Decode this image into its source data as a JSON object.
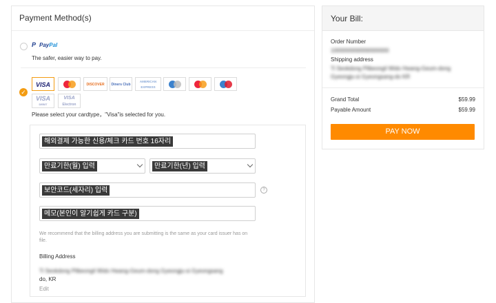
{
  "payment": {
    "title": "Payment Method(s)",
    "paypal": {
      "logo_a": "Pay",
      "logo_b": "Pal",
      "tagline": "The safer, easier way to pay."
    },
    "cards": [
      {
        "name": "VISA",
        "icon": "visa-icon"
      },
      {
        "name": "MasterCard",
        "icon": "mastercard-icon"
      },
      {
        "name": "DISCOVER",
        "icon": "discover-icon"
      },
      {
        "name": "Diners Club",
        "icon": "diners-club-icon"
      },
      {
        "name": "AMERICAN EXPRESS",
        "icon": "amex-icon"
      },
      {
        "name": "JCB",
        "icon": "jcb-icon"
      },
      {
        "name": "CB",
        "icon": "cb-icon"
      },
      {
        "name": "maestro",
        "icon": "maestro-icon"
      },
      {
        "name": "VISA",
        "sub": "DEBIT",
        "icon": "visa-debit-icon"
      },
      {
        "name": "VISA",
        "sub": "Electron",
        "icon": "visa-electron-icon"
      }
    ],
    "select_hint": "Please select your cardtype，\"Visa\"is selected for you.",
    "form": {
      "card_number": "해외결제 가능한 신용/체크 카드 번호 16자리",
      "exp_month": "만료기한(월) 입력",
      "exp_year": "만료기한(년) 입력",
      "cvc": "보안코드(세자리) 입력",
      "memo": "메모(본인이 알기쉽게 카드 구분)",
      "note": "We recommend that the billing address you are submitting is the same as your card issuer has on file.",
      "billing_label": "Billing Address",
      "billing_blurred": "Ti Seokdong Pilbeongil Wido Hwang-Geum-dong Gyeongju-si Gyeongsang",
      "billing_region": "do, KR",
      "edit": "Edit"
    }
  },
  "bill": {
    "title": "Your Bill:",
    "order_label": "Order Number",
    "order_blurred": "1000000000000000000",
    "ship_label": "Shipping address",
    "ship_blurred_1": "Ti Seokdong Pilbeongil Wido Hwang-Geum-dong",
    "ship_blurred_2": "Gyeongju-si Gyeongsang-do KR",
    "grand_total_label": "Grand Total",
    "grand_total_value": "$59.99",
    "payable_label": "Payable Amount",
    "payable_value": "$59.99",
    "pay_button": "PAY NOW"
  },
  "colors": {
    "accent": "#ff8a00",
    "check": "#f39c12"
  }
}
